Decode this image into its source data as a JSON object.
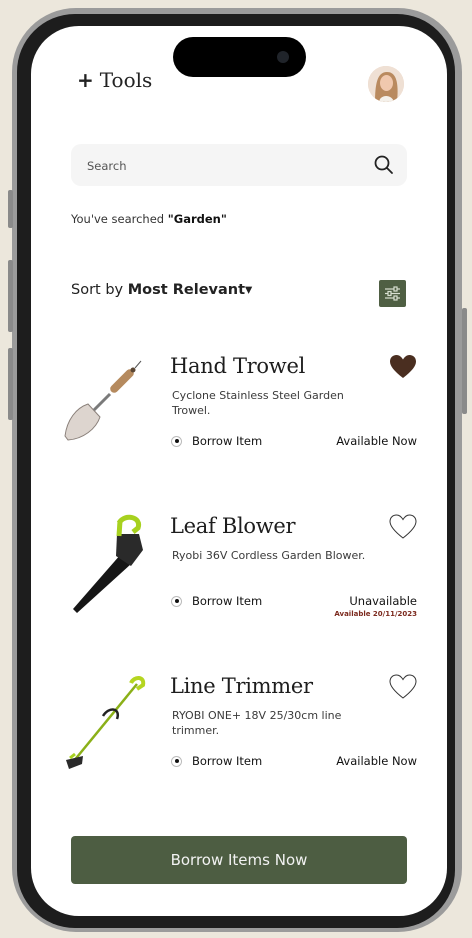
{
  "header": {
    "plus": "+",
    "title": "Tools"
  },
  "search": {
    "placeholder": "Search",
    "value": ""
  },
  "searched": {
    "prefix": "You've searched",
    "query": "\"Garden\""
  },
  "sort": {
    "label": "Sort by",
    "value": "Most Relevant",
    "caret": "▾"
  },
  "colors": {
    "accent": "#4d5d42",
    "heart_filled": "#4a2e20",
    "unavailable_date": "#7c2a1e"
  },
  "items": [
    {
      "name": "Hand Trowel",
      "description": "Cyclone Stainless Steel Garden Trowel.",
      "borrow_label": "Borrow Item",
      "status": "Available Now",
      "available_date": "",
      "favorited": true,
      "icon": "trowel-icon"
    },
    {
      "name": "Leaf Blower",
      "description": "Ryobi 36V Cordless Garden Blower.",
      "borrow_label": "Borrow Item",
      "status": "Unavailable",
      "available_date": "Available 20/11/2023",
      "favorited": false,
      "icon": "leaf-blower-icon"
    },
    {
      "name": "Line Trimmer",
      "description": "RYOBI ONE+ 18V 25/30cm line trimmer.",
      "borrow_label": "Borrow Item",
      "status": "Available Now",
      "available_date": "",
      "favorited": false,
      "icon": "line-trimmer-icon"
    }
  ],
  "cta": {
    "label": "Borrow Items Now"
  }
}
